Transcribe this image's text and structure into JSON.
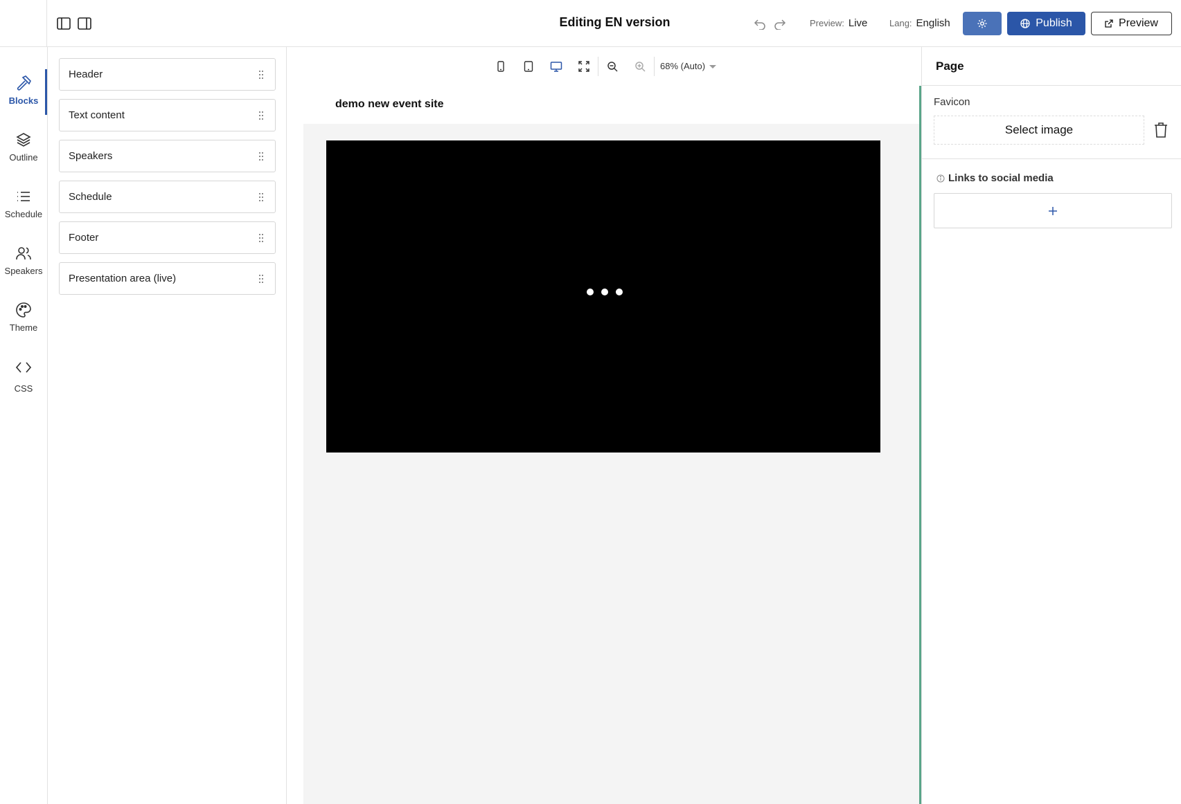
{
  "topbar": {
    "title": "Editing EN version",
    "preview_key": "Preview:",
    "preview_value": "Live",
    "lang_key": "Lang:",
    "lang_value": "English",
    "publish_label": "Publish",
    "preview_label": "Preview"
  },
  "rail": {
    "items": [
      {
        "label": "Blocks",
        "icon": "hammer-icon",
        "active": true
      },
      {
        "label": "Outline",
        "icon": "layers-icon"
      },
      {
        "label": "Schedule",
        "icon": "list-icon"
      },
      {
        "label": "Speakers",
        "icon": "users-icon"
      },
      {
        "label": "Theme",
        "icon": "palette-icon"
      },
      {
        "label": "CSS",
        "icon": "code-icon"
      }
    ]
  },
  "blocks": {
    "items": [
      {
        "label": "Header"
      },
      {
        "label": "Text content"
      },
      {
        "label": "Speakers"
      },
      {
        "label": "Schedule"
      },
      {
        "label": "Footer"
      },
      {
        "label": "Presentation area (live)"
      }
    ]
  },
  "canvas": {
    "zoom_label": "68% (Auto)",
    "site_title": "demo new event site",
    "accent": "#5aa589"
  },
  "props": {
    "title": "Page",
    "favicon_label": "Favicon",
    "select_image_label": "Select image",
    "social_label": "Links to social media"
  },
  "colors": {
    "primary": "#2b56a8",
    "settings": "#4a72b8"
  }
}
